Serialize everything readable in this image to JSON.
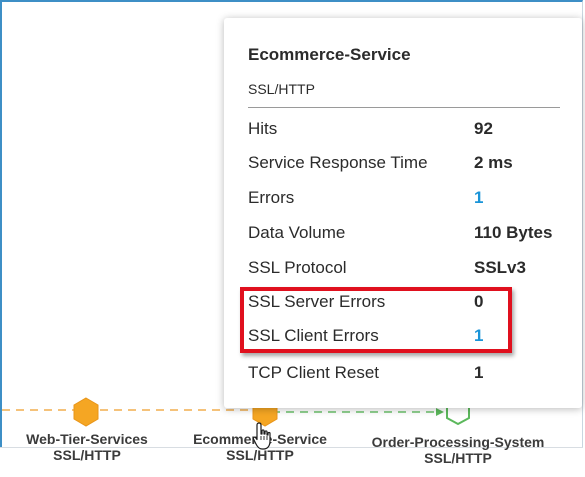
{
  "colors": {
    "frame_border": "#3d8fc6",
    "link_value": "#1a94d8",
    "highlight_box": "#e0101e",
    "node_web": "#f5a623",
    "node_ecom": "#f5a623",
    "node_order": "#5cb85c"
  },
  "nodes": [
    {
      "name": "Web-Tier-Services",
      "protocol": "SSL/HTTP",
      "icon": "hexagon-orange-icon"
    },
    {
      "name": "Ecommerce-Service",
      "protocol": "SSL/HTTP",
      "icon": "hexagon-orange-icon"
    },
    {
      "name": "Order-Processing-System",
      "protocol": "SSL/HTTP",
      "icon": "hexagon-green-outline-icon"
    }
  ],
  "tooltip": {
    "title": "Ecommerce-Service",
    "subtitle": "SSL/HTTP",
    "rows": [
      {
        "label": "Hits",
        "value": "92"
      },
      {
        "label": "Service Response Time",
        "value": "2 ms"
      },
      {
        "label": "Errors",
        "value": "1"
      },
      {
        "label": "Data Volume",
        "value": "110 Bytes"
      },
      {
        "label": "SSL Protocol",
        "value": "SSLv3"
      },
      {
        "label": "SSL Server Errors",
        "value": "0"
      },
      {
        "label": "SSL Client Errors",
        "value": "1"
      },
      {
        "label": "TCP Client Reset",
        "value": "1"
      }
    ]
  },
  "cursor": "hand-pointer-icon"
}
